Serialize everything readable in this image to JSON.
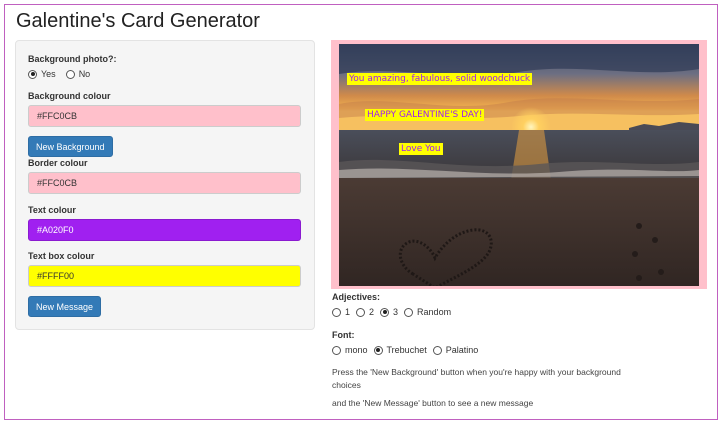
{
  "app": {
    "title": "Galentine's Card Generator"
  },
  "sidebar": {
    "bg_photo_label": "Background photo?:",
    "bg_photo_options": [
      "Yes",
      "No"
    ],
    "bg_photo_selected": "Yes",
    "bg_colour_label": "Background colour",
    "bg_colour_value": "#FFC0CB",
    "new_background_label": "New Background",
    "border_colour_label": "Border colour",
    "border_colour_value": "#FFC0CB",
    "text_colour_label": "Text colour",
    "text_colour_value": "#A020F0",
    "textbox_colour_label": "Text box colour",
    "textbox_colour_value": "#FFFF00",
    "new_message_label": "New Message"
  },
  "card": {
    "line1": "You amazing, fabulous, solid woodchuck",
    "line2": "HAPPY GALENTINE'S DAY!",
    "line3": "Love You",
    "border_color": "#FFC0CB",
    "text_color": "#A020F0",
    "textbox_color": "#FFFF00"
  },
  "controls": {
    "adjectives_label": "Adjectives:",
    "adjective_options": [
      "1",
      "2",
      "3",
      "Random"
    ],
    "adjective_selected": "3",
    "font_label": "Font:",
    "font_options": [
      "mono",
      "Trebuchet",
      "Palatino"
    ],
    "font_selected": "Trebuchet"
  },
  "help": {
    "line1": "Press the 'New Background' button when you're happy with your background choices",
    "line2": "and the 'New Message' button to see a new message"
  }
}
